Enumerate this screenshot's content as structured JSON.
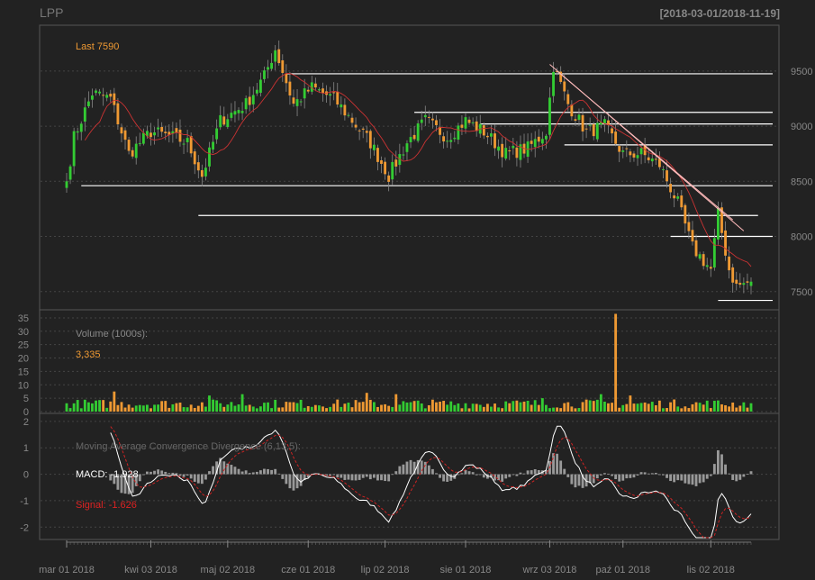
{
  "header": {
    "symbol": "LPP",
    "date_range": "[2018-03-01/2018-11-19]"
  },
  "colors": {
    "background": "#222222",
    "up": "#33cc33",
    "down": "#ee9933",
    "grid": "#444444",
    "text": "#888888",
    "accent": "#ee9933",
    "ma": "#cc3333",
    "trendline": "#ffbbbb",
    "level": "#ffffff",
    "macd": "#ffffff",
    "signal": "#cc2222"
  },
  "chart_data": [
    {
      "panel": "price",
      "type": "candlestick",
      "ylim": [
        7400,
        9850
      ],
      "y_ticks": [
        7500,
        8000,
        8500,
        9000,
        9500
      ],
      "annotation": "Last 7590",
      "moving_average": "red",
      "anchors": [
        {
          "t": "2018-03-01",
          "v": 8500
        },
        {
          "t": "2018-03-05",
          "v": 8900
        },
        {
          "t": "2018-03-12",
          "v": 9300
        },
        {
          "t": "2018-03-19",
          "v": 9250
        },
        {
          "t": "2018-03-26",
          "v": 8750
        },
        {
          "t": "2018-04-03",
          "v": 8950
        },
        {
          "t": "2018-04-11",
          "v": 8900
        },
        {
          "t": "2018-04-17",
          "v": 8850
        },
        {
          "t": "2018-04-23",
          "v": 8550
        },
        {
          "t": "2018-04-30",
          "v": 9050
        },
        {
          "t": "2018-05-09",
          "v": 9200
        },
        {
          "t": "2018-05-16",
          "v": 9450
        },
        {
          "t": "2018-05-21",
          "v": 9700
        },
        {
          "t": "2018-05-28",
          "v": 9200
        },
        {
          "t": "2018-06-04",
          "v": 9350
        },
        {
          "t": "2018-06-12",
          "v": 9250
        },
        {
          "t": "2018-06-19",
          "v": 9050
        },
        {
          "t": "2018-06-26",
          "v": 8850
        },
        {
          "t": "2018-07-03",
          "v": 8550
        },
        {
          "t": "2018-07-10",
          "v": 8850
        },
        {
          "t": "2018-07-17",
          "v": 9050
        },
        {
          "t": "2018-07-25",
          "v": 8900
        },
        {
          "t": "2018-08-01",
          "v": 9050
        },
        {
          "t": "2018-08-08",
          "v": 8950
        },
        {
          "t": "2018-08-16",
          "v": 8750
        },
        {
          "t": "2018-08-24",
          "v": 8800
        },
        {
          "t": "2018-08-31",
          "v": 8950
        },
        {
          "t": "2018-09-04",
          "v": 9550
        },
        {
          "t": "2018-09-10",
          "v": 9200
        },
        {
          "t": "2018-09-17",
          "v": 8950
        },
        {
          "t": "2018-09-24",
          "v": 9000
        },
        {
          "t": "2018-10-01",
          "v": 8750
        },
        {
          "t": "2018-10-08",
          "v": 8750
        },
        {
          "t": "2018-10-15",
          "v": 8650
        },
        {
          "t": "2018-10-22",
          "v": 8300
        },
        {
          "t": "2018-10-26",
          "v": 7900
        },
        {
          "t": "2018-11-02",
          "v": 7700
        },
        {
          "t": "2018-11-06",
          "v": 8200
        },
        {
          "t": "2018-11-09",
          "v": 7700
        },
        {
          "t": "2018-11-13",
          "v": 7550
        },
        {
          "t": "2018-11-19",
          "v": 7590
        }
      ],
      "levels": [
        {
          "value": 9475,
          "from": "2018-05-24",
          "to": "2018-11-19"
        },
        {
          "value": 9125,
          "from": "2018-07-12",
          "to": "2018-11-19"
        },
        {
          "value": 9020,
          "from": "2018-08-07",
          "to": "2018-11-19"
        },
        {
          "value": 8830,
          "from": "2018-09-07",
          "to": "2018-11-19"
        },
        {
          "value": 8460,
          "from": "2018-03-07",
          "to": "2018-11-19"
        },
        {
          "value": 8190,
          "from": "2018-04-20",
          "to": "2018-11-13"
        },
        {
          "value": 8000,
          "from": "2018-10-18",
          "to": "2018-11-19"
        },
        {
          "value": 7420,
          "from": "2018-11-06",
          "to": "2018-11-19"
        }
      ],
      "trendlines": [
        {
          "from": {
            "t": "2018-09-03",
            "v": 9560
          },
          "to": {
            "t": "2018-11-15",
            "v": 8050
          }
        },
        {
          "from": {
            "t": "2018-09-05",
            "v": 9500
          },
          "to": {
            "t": "2018-11-12",
            "v": 8150
          }
        }
      ]
    },
    {
      "panel": "volume",
      "type": "bar",
      "title": "Volume (1000s):",
      "last_value": "3,335",
      "ylim": [
        0,
        37
      ],
      "y_ticks": [
        0,
        5,
        10,
        15,
        20,
        25,
        30,
        35
      ],
      "spikes": [
        {
          "t": "2018-03-20",
          "v": 7.5
        },
        {
          "t": "2018-04-25",
          "v": 6
        },
        {
          "t": "2018-05-08",
          "v": 6.5
        },
        {
          "t": "2018-06-25",
          "v": 7
        },
        {
          "t": "2018-07-05",
          "v": 6.5
        },
        {
          "t": "2018-08-30",
          "v": 5
        },
        {
          "t": "2018-09-21",
          "v": 6.5
        },
        {
          "t": "2018-09-27",
          "v": 36.5
        },
        {
          "t": "2018-10-03",
          "v": 6
        }
      ]
    },
    {
      "panel": "macd",
      "type": "line",
      "title": "Moving Average Convergence Divergence (6,13,5):",
      "macd_label": "MACD: -1.928",
      "signal_label": "Signal: -1.626",
      "ylim": [
        -2.4,
        2.2
      ],
      "y_ticks": [
        -2,
        -1,
        0,
        1,
        2
      ]
    }
  ],
  "x_axis": {
    "ticks": [
      {
        "t": "2018-03-01",
        "label": "mar 01 2018"
      },
      {
        "t": "2018-04-03",
        "label": "kwi 03 2018"
      },
      {
        "t": "2018-05-02",
        "label": "maj 02 2018"
      },
      {
        "t": "2018-06-01",
        "label": "cze 01 2018"
      },
      {
        "t": "2018-07-02",
        "label": "lip 02 2018"
      },
      {
        "t": "2018-08-01",
        "label": "sie 01 2018"
      },
      {
        "t": "2018-09-03",
        "label": "wrz 03 2018"
      },
      {
        "t": "2018-10-01",
        "label": "paź 01 2018"
      },
      {
        "t": "2018-11-02",
        "label": "lis 02 2018"
      }
    ]
  }
}
